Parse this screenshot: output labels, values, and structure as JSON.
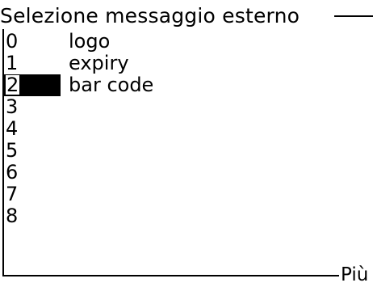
{
  "screen": {
    "title": "Selezione messaggio esterno",
    "more_label": "Più",
    "selected_index": 2,
    "messages": [
      {
        "slot": "0",
        "name": "logo"
      },
      {
        "slot": "1",
        "name": "expiry"
      },
      {
        "slot": "2",
        "name": "bar code"
      },
      {
        "slot": "3",
        "name": ""
      },
      {
        "slot": "4",
        "name": ""
      },
      {
        "slot": "5",
        "name": ""
      },
      {
        "slot": "6",
        "name": ""
      },
      {
        "slot": "7",
        "name": ""
      },
      {
        "slot": "8",
        "name": ""
      }
    ]
  }
}
